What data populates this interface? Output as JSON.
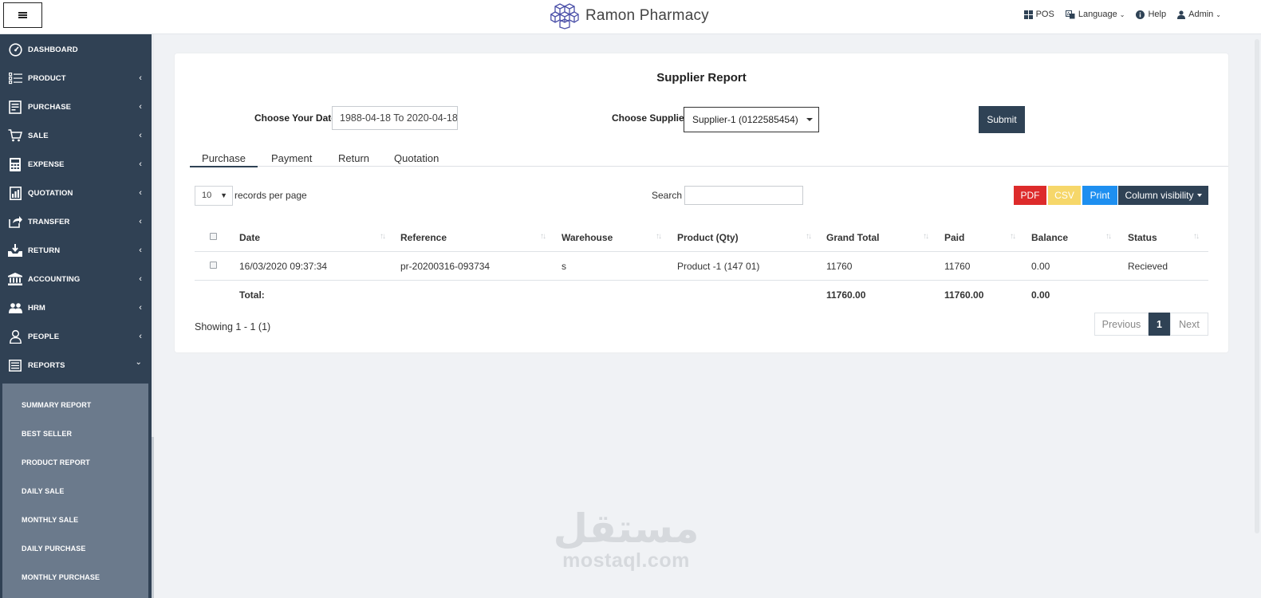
{
  "app": {
    "title": "Ramon Pharmacy"
  },
  "topnav": {
    "pos": "POS",
    "language": "Language",
    "help": "Help",
    "admin": "Admin"
  },
  "sidebar": {
    "items": [
      {
        "label": "DASHBOARD",
        "icon": "dashboard-icon"
      },
      {
        "label": "PRODUCT",
        "icon": "list-icon"
      },
      {
        "label": "PURCHASE",
        "icon": "purchase-icon"
      },
      {
        "label": "SALE",
        "icon": "cart-icon"
      },
      {
        "label": "EXPENSE",
        "icon": "calculator-icon"
      },
      {
        "label": "QUOTATION",
        "icon": "quotation-icon"
      },
      {
        "label": "TRANSFER",
        "icon": "transfer-icon"
      },
      {
        "label": "RETURN",
        "icon": "return-icon"
      },
      {
        "label": "ACCOUNTING",
        "icon": "bank-icon"
      },
      {
        "label": "HRM",
        "icon": "users-icon"
      },
      {
        "label": "PEOPLE",
        "icon": "user-icon"
      },
      {
        "label": "REPORTS",
        "icon": "report-icon"
      }
    ],
    "submenu": [
      "SUMMARY REPORT",
      "BEST SELLER",
      "PRODUCT REPORT",
      "DAILY SALE",
      "MONTHLY SALE",
      "DAILY PURCHASE",
      "MONTHLY PURCHASE"
    ]
  },
  "report": {
    "title": "Supplier Report",
    "date_label": "Choose Your Date",
    "date_value": "1988-04-18 To 2020-04-18",
    "supplier_label": "Choose Supplier",
    "supplier_value": "Supplier-1 (0122585454)",
    "submit": "Submit"
  },
  "tabs": [
    "Purchase",
    "Payment",
    "Return",
    "Quotation"
  ],
  "table_controls": {
    "length_value": "10",
    "length_label": "records per page",
    "search_label": "Search",
    "buttons": {
      "pdf": "PDF",
      "csv": "CSV",
      "print": "Print",
      "colvis": "Column visibility"
    }
  },
  "table": {
    "headers": [
      "Date",
      "Reference",
      "Warehouse",
      "Product (Qty)",
      "Grand Total",
      "Paid",
      "Balance",
      "Status"
    ],
    "rows": [
      [
        "16/03/2020 09:37:34",
        "pr-20200316-093734",
        "s",
        "Product -1 (147 01)",
        "11760",
        "11760",
        "0.00",
        "Recieved"
      ]
    ],
    "total": {
      "label": "Total:",
      "grand_total": "11760.00",
      "paid": "11760.00",
      "balance": "0.00"
    }
  },
  "footer": {
    "showing": "Showing 1 - 1 (1)",
    "previous": "Previous",
    "page": "1",
    "next": "Next"
  },
  "watermark": {
    "arabic": "مستقل",
    "latin": "mostaql.com"
  },
  "colors": {
    "sidebar": "#304154",
    "submenu": "#6b7a8c",
    "primary": "#2f4255",
    "pdf": "#dd2b2b",
    "csv": "#f6d76a",
    "print": "#1e8ff0"
  }
}
